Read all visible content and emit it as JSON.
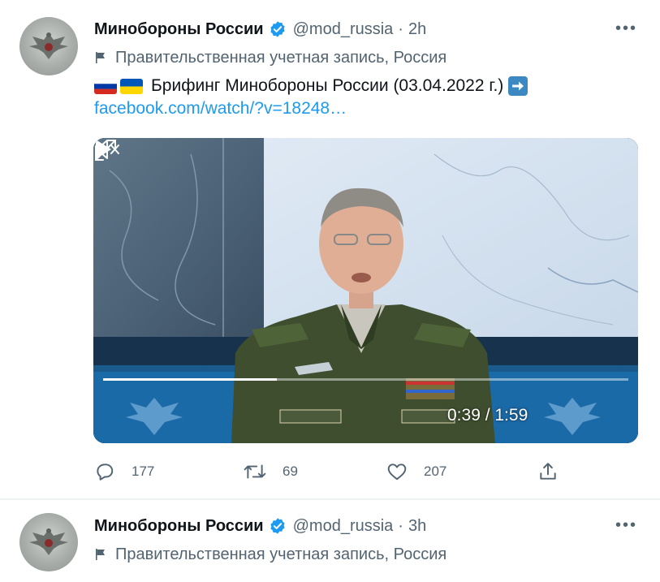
{
  "tweets": [
    {
      "author": "Минобороны России",
      "handle": "@mod_russia",
      "separator": "·",
      "time": "2h",
      "more": "•••",
      "label": "Правительственная учетная запись, Россия",
      "text": "Брифинг Минобороны России (03.04.2022 г.)",
      "link": "facebook.com/watch/?v=18248…",
      "video": {
        "elapsed": "0:39",
        "duration": "1:59",
        "time_text": "0:39 / 1:59",
        "progress": 0.33
      },
      "actions": {
        "replies": "177",
        "retweets": "69",
        "likes": "207"
      }
    },
    {
      "author": "Минобороны России",
      "handle": "@mod_russia",
      "separator": "·",
      "time": "3h",
      "more": "•••",
      "label": "Правительственная учетная запись, Россия"
    }
  ],
  "colors": {
    "verified": "#1d9bf0",
    "link": "#1d9bf0",
    "secondary_text": "#536471",
    "primary_text": "#0f1419"
  },
  "icons": {
    "verified": "verified-badge-icon",
    "label": "flag-icon",
    "reply": "reply-icon",
    "retweet": "retweet-icon",
    "like": "heart-icon",
    "share": "share-icon",
    "play": "play-icon",
    "mute": "mute-icon",
    "fullscreen": "fullscreen-icon",
    "flags": [
      "russia-flag-icon",
      "ukraine-flag-icon"
    ],
    "arrow": "right-arrow-icon"
  }
}
